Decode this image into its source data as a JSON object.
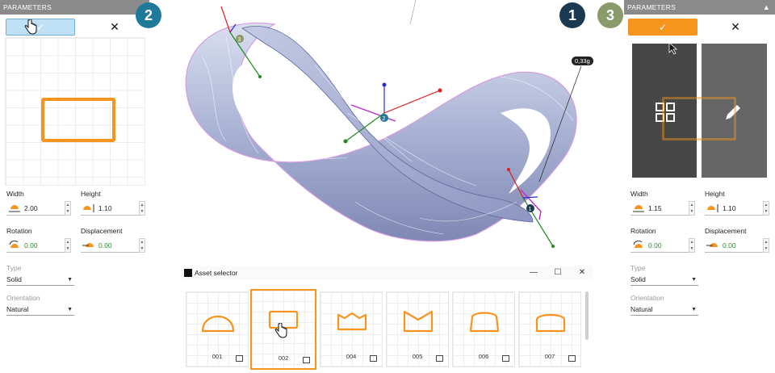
{
  "left_panel": {
    "header": "PARAMETERS",
    "confirm_label": "✓",
    "cancel_label": "✕",
    "width_label": "Width",
    "width_value": "2.00",
    "height_label": "Height",
    "height_value": "1.10",
    "rotation_label": "Rotation",
    "rotation_value": "0.00",
    "displacement_label": "Displacement",
    "displacement_value": "0.00",
    "type_label": "Type",
    "type_value": "Solid",
    "orientation_label": "Orientation",
    "orientation_value": "Natural"
  },
  "right_panel": {
    "header": "PARAMETERS",
    "collapse_icon": "▲",
    "confirm_label": "✓",
    "cancel_label": "✕",
    "width_label": "Width",
    "width_value": "1.15",
    "height_label": "Height",
    "height_value": "1.10",
    "rotation_label": "Rotation",
    "rotation_value": "0.00",
    "displacement_label": "Displacement",
    "displacement_value": "0.00",
    "type_label": "Type",
    "type_value": "Solid",
    "orientation_label": "Orientation",
    "orientation_value": "Natural"
  },
  "badges": {
    "b1": "1",
    "b2": "2",
    "b3": "3"
  },
  "viewport": {
    "dimension_tag": "0,33g",
    "marker_1": "1",
    "marker_2": "2",
    "marker_3": "3"
  },
  "asset_selector": {
    "title": "Asset selector",
    "minimize": "—",
    "maximize": "☐",
    "close": "✕",
    "assets": [
      {
        "label": "001"
      },
      {
        "label": "002"
      },
      {
        "label": "004"
      },
      {
        "label": "005"
      },
      {
        "label": "006"
      },
      {
        "label": "007"
      }
    ]
  },
  "colors": {
    "accent": "#f7941d",
    "badge_1": "#1b3a52",
    "badge_2": "#1f7a99",
    "badge_3": "#8b9a6b",
    "panel_header": "#8a8a8a"
  }
}
